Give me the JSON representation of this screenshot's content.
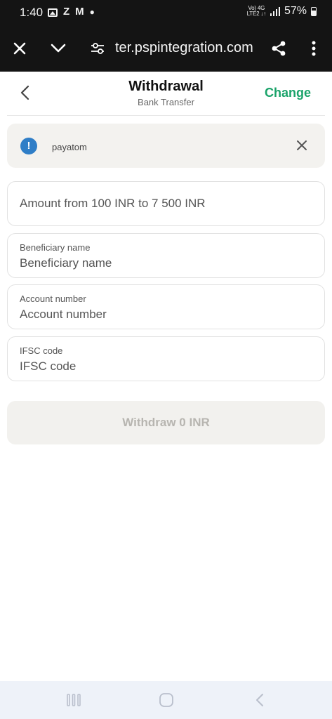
{
  "status_bar": {
    "time": "1:40",
    "icons": [
      "photo-icon",
      "z-app-icon",
      "gmail-icon",
      "dot-icon"
    ],
    "network_top": "Vo) 4G",
    "network_bottom": "LTE2 ↓↑",
    "battery": "57%"
  },
  "browser": {
    "url": "ter.pspintegration.com",
    "icons": [
      "close-icon",
      "chevron-down-icon",
      "tune-icon",
      "share-icon",
      "more-vert-icon"
    ]
  },
  "header": {
    "title": "Withdrawal",
    "subtitle": "Bank Transfer",
    "change_label": "Change"
  },
  "banner": {
    "text": "payatom",
    "info_glyph": "!",
    "colors": {
      "icon_bg": "#2f7ec7",
      "bg": "#f3f2ef"
    }
  },
  "form": {
    "amount": {
      "placeholder": "Amount from 100 INR to 7 500 INR",
      "value": ""
    },
    "beneficiary": {
      "label": "Beneficiary name",
      "placeholder": "Beneficiary name",
      "value": ""
    },
    "account": {
      "label": "Account number",
      "placeholder": "Account number",
      "value": ""
    },
    "ifsc": {
      "label": "IFSC code",
      "placeholder": "IFSC code",
      "value": ""
    }
  },
  "withdraw_button": {
    "label": "Withdraw 0 INR",
    "disabled": true
  },
  "theme": {
    "accent": "#1aa36a",
    "toolbar_bg": "#141414"
  },
  "nav": {
    "icons": [
      "recents-icon",
      "home-icon",
      "back-nav-icon"
    ]
  }
}
